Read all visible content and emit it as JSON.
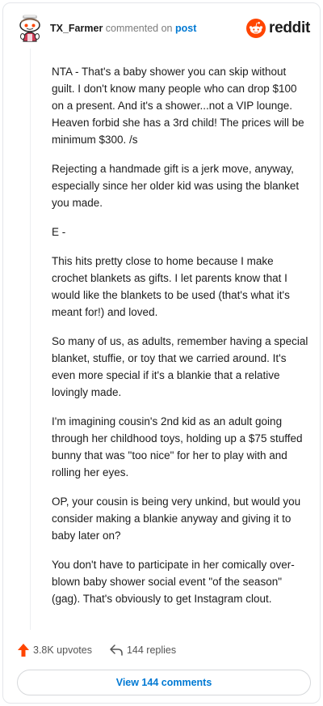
{
  "header": {
    "username": "TX_Farmer",
    "commented_text": "commented on",
    "post_link": "post",
    "logo_text": "reddit",
    "brand_color": "#ff4500",
    "avatar_icon": "snoo-avatar-icon"
  },
  "comment": {
    "paragraphs": [
      "NTA - That's a baby shower you can skip without guilt. I don't know many people who can drop $100 on a present. And it's a shower...not a VIP lounge. Heaven forbid she has a 3rd child! The prices will be minimum $300. /s",
      "Rejecting a handmade gift is a jerk move, anyway, especially since her older kid was using the blanket you made.",
      "E -",
      "This hits pretty close to home because I make crochet blankets as gifts. I let parents know that I would like the blankets to be used (that's what it's meant for!) and loved.",
      "So many of us, as adults, remember having a special blanket, stuffie, or toy that we carried around. It's even more special if it's a blankie that a relative lovingly made.",
      "I'm imagining cousin's 2nd kid as an adult going through her childhood toys, holding up a $75 stuffed bunny that was \"too nice\" for her to play with and rolling her eyes.",
      "OP, your cousin is being very unkind, but would you consider making a blankie anyway and giving it to baby later on?",
      "You don't have to participate in her comically over-blown baby shower social event \"of the season\" (gag). That's obviously to get Instagram clout."
    ]
  },
  "actions": {
    "upvotes": "3.8K upvotes",
    "replies": "144 replies",
    "upvote_color": "#ff4500"
  },
  "footer": {
    "view_comments": "View 144 comments"
  }
}
